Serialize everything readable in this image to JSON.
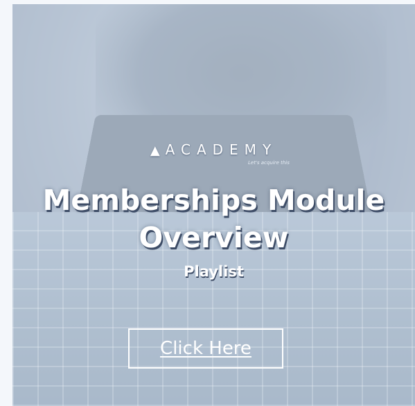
{
  "banner": {
    "brand": "ACADEMY",
    "tagline": "Let's acquire this",
    "title_line1": "Memberships Module",
    "title_line2": "Overview",
    "subtitle": "Playlist",
    "button_label": "Click Here",
    "logo_icon": "academy-logo-icon"
  },
  "colors": {
    "text": "#ffffff",
    "title_shadow": "#3d4c66",
    "page_background": "#f4f7fb"
  }
}
